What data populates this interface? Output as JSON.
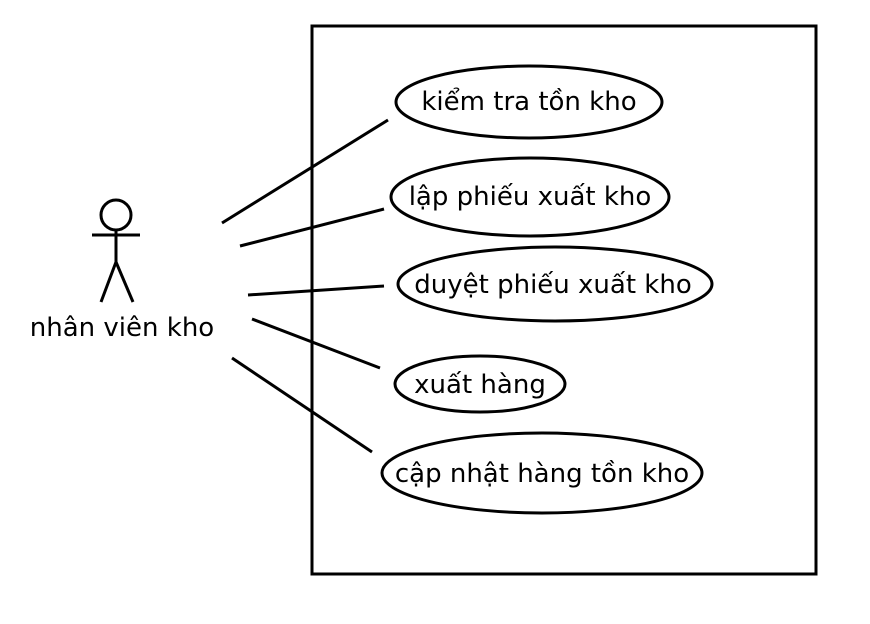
{
  "actor": {
    "name": "nhân viên kho"
  },
  "use_cases": [
    {
      "label": "kiểm tra tồn kho"
    },
    {
      "label": "lập phiếu xuất kho"
    },
    {
      "label": "duyệt phiếu xuất kho"
    },
    {
      "label": "xuất hàng"
    },
    {
      "label": "cập nhật hàng tồn kho"
    }
  ],
  "colors": {
    "stroke": "#000000",
    "background": "#ffffff"
  }
}
